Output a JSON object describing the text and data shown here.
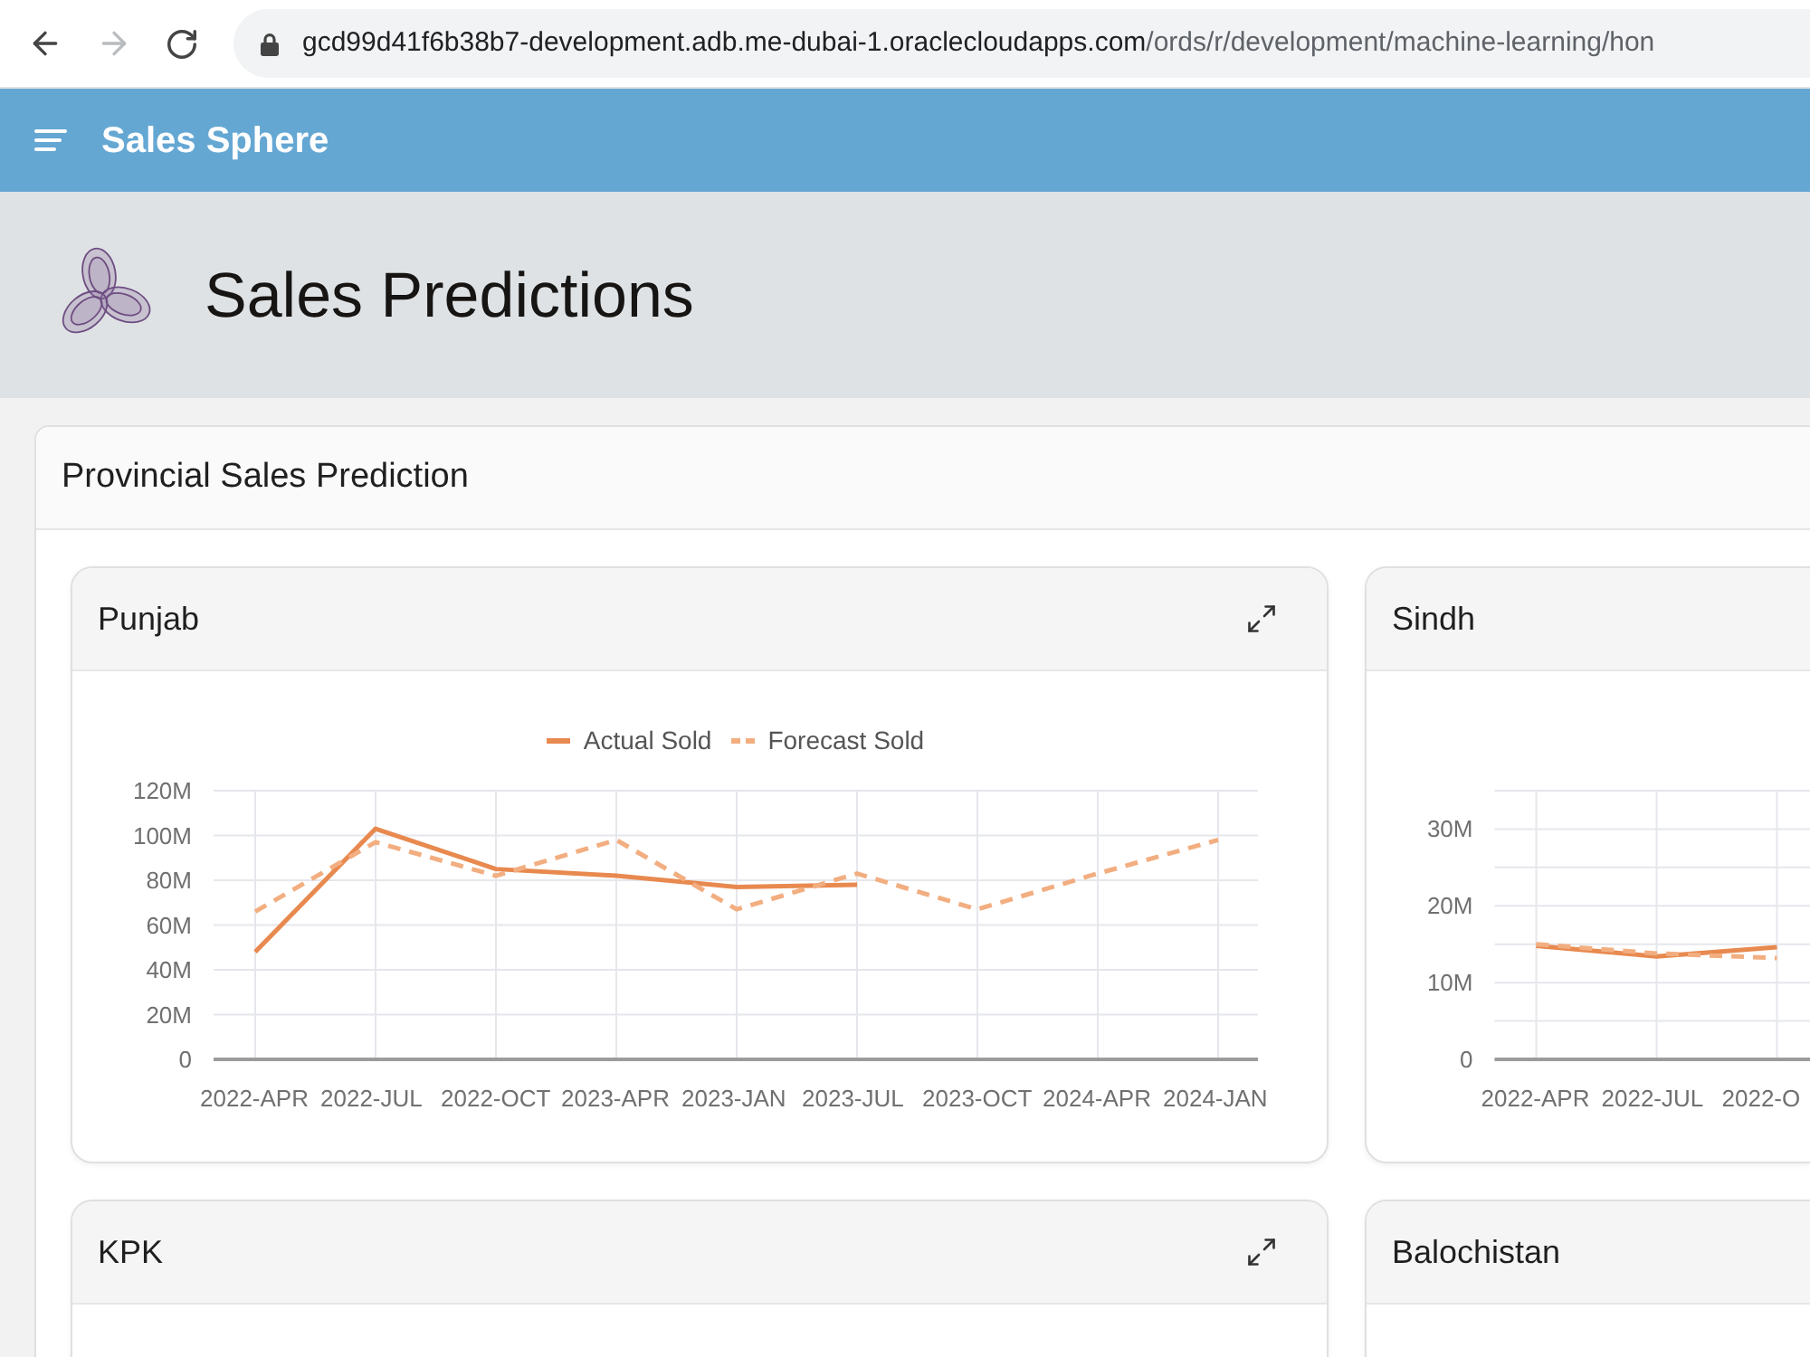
{
  "browser": {
    "url_host": "gcd99d41f6b38b7-development.adb.me-dubai-1.oraclecloudapps.com",
    "url_path": "/ords/r/development/machine-learning/hon",
    "forward_disabled": true
  },
  "app_header": {
    "title": "Sales Sphere"
  },
  "page_header": {
    "title": "Sales Predictions"
  },
  "region": {
    "title": "Provincial Sales Prediction",
    "cards": [
      {
        "title": "Punjab",
        "expand_button": true,
        "chart_data": {
          "type": "line",
          "categories": [
            "2022-APR",
            "2022-JUL",
            "2022-OCT",
            "2023-APR",
            "2023-JAN",
            "2023-JUL",
            "2023-OCT",
            "2024-APR",
            "2024-JAN"
          ],
          "series": [
            {
              "name": "Actual Sold",
              "color": "#e8894f",
              "line_style": "solid",
              "values": [
                48000000,
                103000000,
                85000000,
                82000000,
                77000000,
                78000000,
                null,
                null,
                null
              ]
            },
            {
              "name": "Forecast Sold",
              "color": "#f2ae80",
              "line_style": "dashed",
              "values": [
                66000000,
                97000000,
                82000000,
                98000000,
                67000000,
                83000000,
                67000000,
                83000000,
                98000000
              ]
            }
          ],
          "ylim": [
            0,
            120000000
          ],
          "yticks": [
            {
              "value": 0,
              "label": "0"
            },
            {
              "value": 20000000,
              "label": "20M"
            },
            {
              "value": 40000000,
              "label": "40M"
            },
            {
              "value": 60000000,
              "label": "60M"
            },
            {
              "value": 80000000,
              "label": "80M"
            },
            {
              "value": 100000000,
              "label": "100M"
            },
            {
              "value": 120000000,
              "label": "120M"
            }
          ],
          "grid": true,
          "legend": true
        }
      },
      {
        "title": "Sindh",
        "chart_data": {
          "type": "line",
          "categories": [
            "2022-APR",
            "2022-JUL",
            "2022-O"
          ],
          "series": [
            {
              "color": "#e8894f",
              "line_style": "solid",
              "values": [
                14800000,
                13400000,
                14600000
              ]
            },
            {
              "color": "#f2ae80",
              "line_style": "dashed",
              "values": [
                15000000,
                13800000,
                13200000
              ]
            }
          ],
          "ylim": [
            0,
            35000000
          ],
          "yticks": [
            {
              "value": 0,
              "label": "0"
            },
            {
              "value": 10000000,
              "label": "10M"
            },
            {
              "value": 20000000,
              "label": "20M"
            },
            {
              "value": 30000000,
              "label": "30M"
            }
          ],
          "grid": true
        }
      },
      {
        "title": "KPK",
        "expand_button": true
      },
      {
        "title": "Balochistan"
      }
    ]
  }
}
